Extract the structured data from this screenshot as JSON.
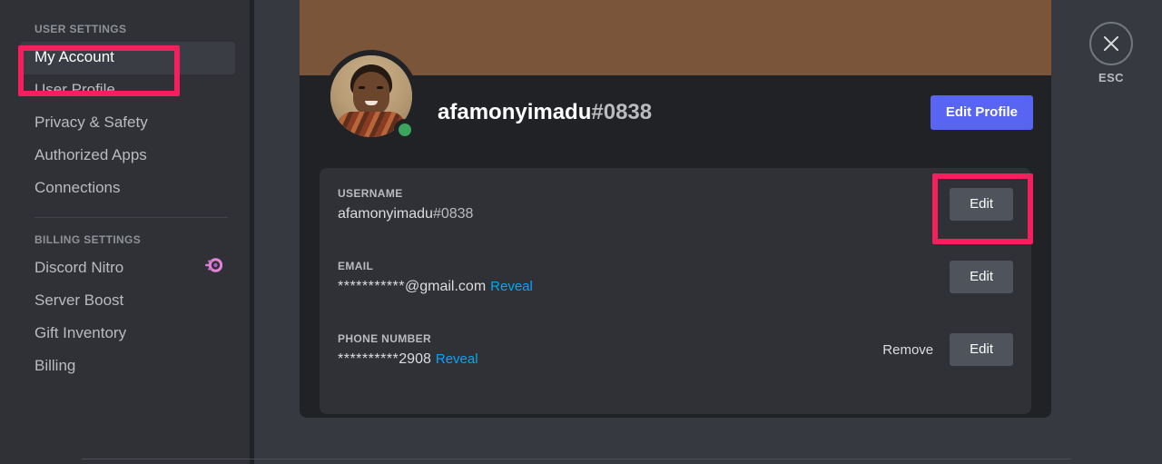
{
  "sidebar": {
    "sections": [
      {
        "header": "USER SETTINGS",
        "items": [
          {
            "label": "My Account",
            "selected": true,
            "badge": null
          },
          {
            "label": "User Profile",
            "selected": false,
            "badge": null
          },
          {
            "label": "Privacy & Safety",
            "selected": false,
            "badge": null
          },
          {
            "label": "Authorized Apps",
            "selected": false,
            "badge": null
          },
          {
            "label": "Connections",
            "selected": false,
            "badge": null
          }
        ]
      },
      {
        "header": "BILLING SETTINGS",
        "items": [
          {
            "label": "Discord Nitro",
            "selected": false,
            "badge": "nitro-wheel-icon"
          },
          {
            "label": "Server Boost",
            "selected": false,
            "badge": null
          },
          {
            "label": "Gift Inventory",
            "selected": false,
            "badge": null
          },
          {
            "label": "Billing",
            "selected": false,
            "badge": null
          }
        ]
      }
    ]
  },
  "profile": {
    "banner_color": "#7b553a",
    "username": "afamonyimadu",
    "discriminator": "#0838",
    "status": "online",
    "status_color": "#3ba55d",
    "edit_profile_label": "Edit Profile",
    "edit_profile_color": "#5865f2"
  },
  "fields": [
    {
      "label": "USERNAME",
      "value": "afamonyimadu",
      "value_dim": "#0838",
      "reveal_label": null,
      "remove_label": null,
      "edit_label": "Edit",
      "highlighted": true
    },
    {
      "label": "EMAIL",
      "value": "***********",
      "value_dim": "@gmail.com",
      "reveal_label": "Reveal",
      "remove_label": null,
      "edit_label": "Edit",
      "highlighted": false
    },
    {
      "label": "PHONE NUMBER",
      "value": "**********",
      "value_dim": "2908",
      "reveal_label": "Reveal",
      "remove_label": "Remove",
      "edit_label": "Edit",
      "highlighted": false
    }
  ],
  "close": {
    "icon": "close-x-icon",
    "label": "ESC"
  },
  "annotations": {
    "color": "#f61f5e",
    "boxes": [
      {
        "target": "sidebar-item-my-account"
      },
      {
        "target": "username-edit-button"
      }
    ]
  }
}
